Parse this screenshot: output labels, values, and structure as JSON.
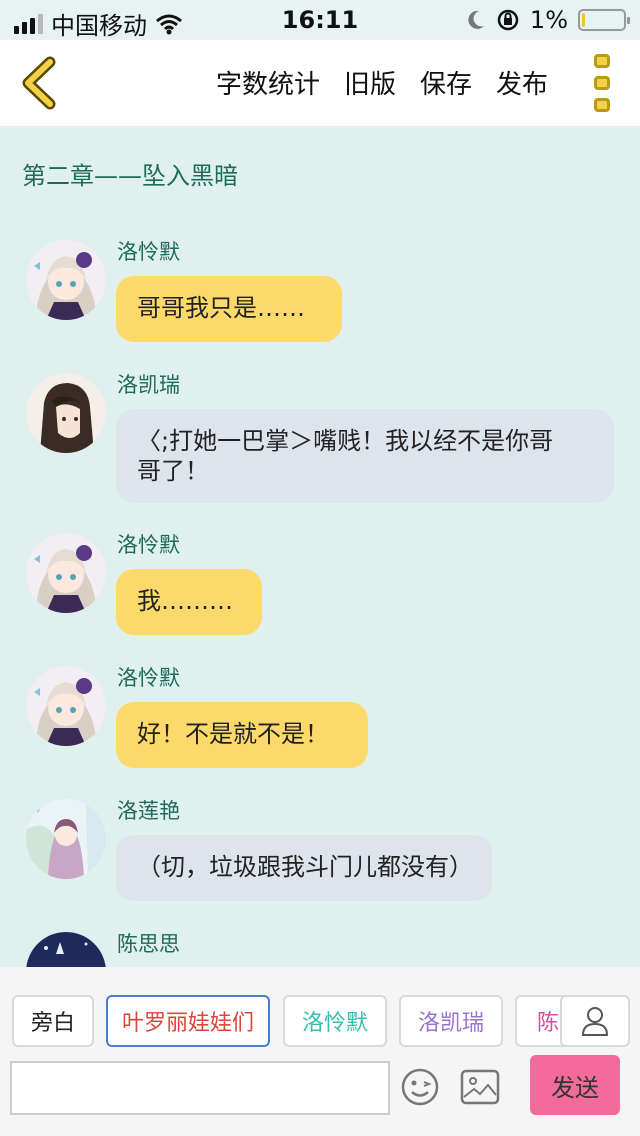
{
  "status_bar": {
    "carrier": "中国移动",
    "time": "16:11",
    "battery_percent": "1%",
    "battery_level": 0.01
  },
  "nav": {
    "word_count": "字数统计",
    "old_version": "旧版",
    "save": "保存",
    "publish": "发布"
  },
  "chapter_title": "第二章——坠入黑暗",
  "messages": [
    {
      "name": "洛怜默",
      "text": "哥哥我只是……",
      "color": "yellow"
    },
    {
      "name": "洛凯瑞",
      "line1": "〈;打她一巴掌＞嘴贱！我以经不是你哥",
      "line2": "哥了！",
      "color": "gray"
    },
    {
      "name": "洛怜默",
      "text": "我………",
      "color": "yellow"
    },
    {
      "name": "洛怜默",
      "text": "好！不是就不是！",
      "color": "yellow"
    },
    {
      "name": "洛莲艳",
      "text": "（切，垃圾跟我斗门儿都没有）",
      "color": "gray"
    },
    {
      "name": "陈思思"
    }
  ],
  "role_chips": [
    {
      "label": "旁白",
      "color": "#222222"
    },
    {
      "label": "叶罗丽娃娃们",
      "color": "#d9463b"
    },
    {
      "label": "洛怜默",
      "color": "#3cbcae"
    },
    {
      "label": "洛凯瑞",
      "color": "#9b72d0"
    },
    {
      "label": "陈思思",
      "color": "#d24ea0"
    }
  ],
  "input": {
    "placeholder": ""
  },
  "send_label": "发送",
  "colors": {
    "accent_pink": "#f36b9a",
    "bubble_yellow": "#fcd96b",
    "bubble_gray": "#dde4ec",
    "name_green": "#1f6b58",
    "background": "#dff0ef"
  }
}
